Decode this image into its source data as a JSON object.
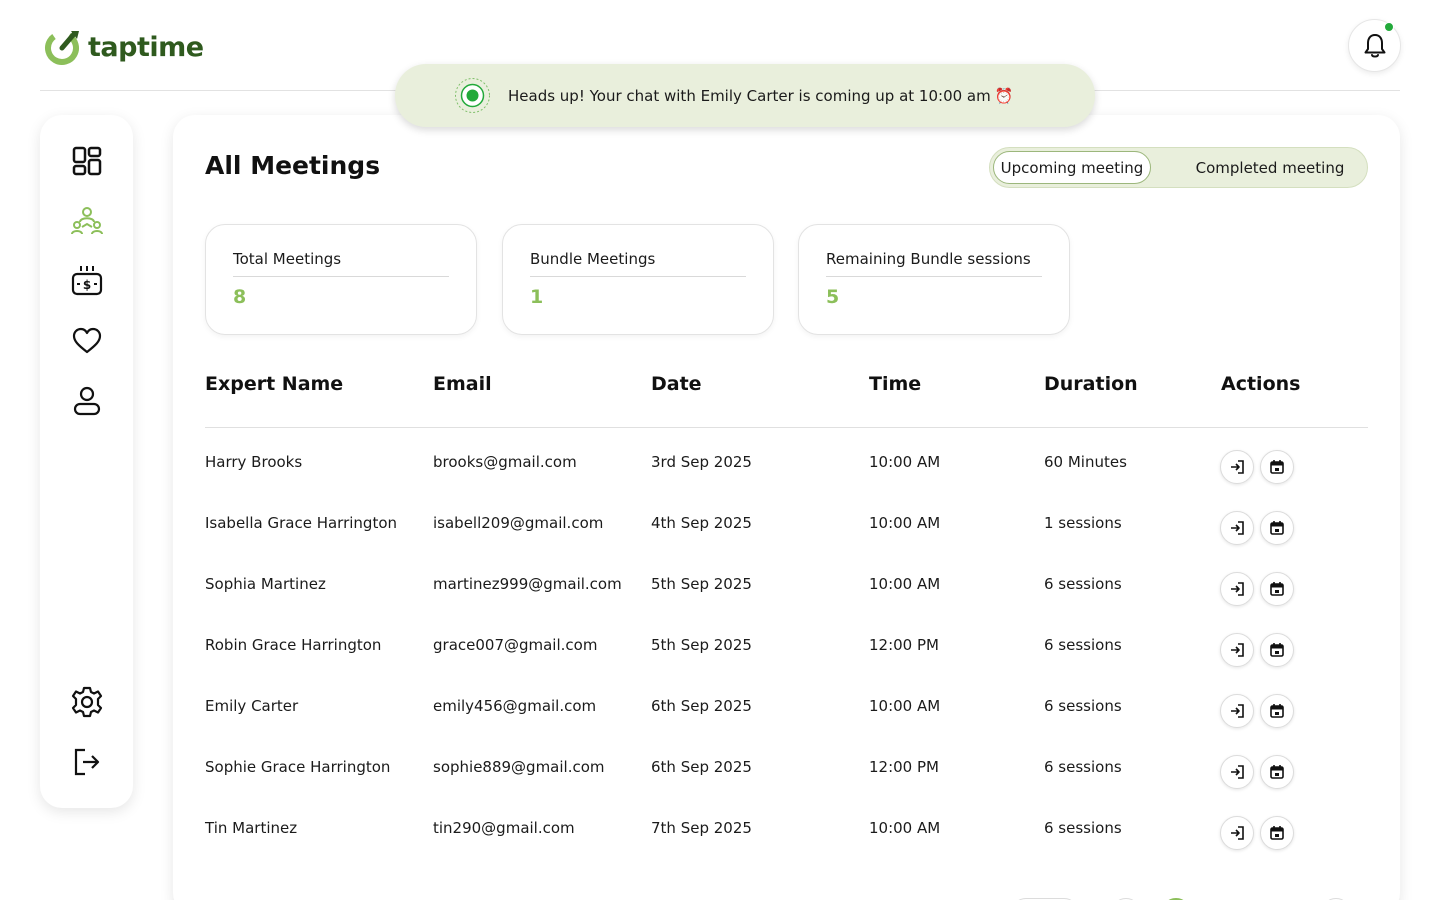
{
  "app": {
    "name": "taptime",
    "brand_color": "#2f5a1e",
    "accent": "#8cbf5a"
  },
  "header": {
    "notification_icon": "bell-icon",
    "has_unread": true
  },
  "toast": {
    "message": "Heads up! Your chat with Emily Carter is coming up at 10:00 am",
    "emoji": "⏰"
  },
  "sidebar": {
    "items": [
      {
        "name": "dashboard",
        "icon": "dashboard-grid-icon",
        "active": false
      },
      {
        "name": "meetings",
        "icon": "group-meeting-icon",
        "active": true
      },
      {
        "name": "payments",
        "icon": "money-box-icon",
        "active": false
      },
      {
        "name": "favorites",
        "icon": "heart-icon",
        "active": false
      },
      {
        "name": "profile",
        "icon": "user-icon",
        "active": false
      }
    ],
    "bottom_items": [
      {
        "name": "settings",
        "icon": "gear-icon"
      },
      {
        "name": "logout",
        "icon": "logout-icon"
      }
    ]
  },
  "main": {
    "title": "All Meetings",
    "tabs": {
      "upcoming": "Upcoming meeting",
      "completed": "Completed meeting",
      "selected": "upcoming"
    },
    "stats": [
      {
        "label": "Total Meetings",
        "value": "8"
      },
      {
        "label": "Bundle Meetings",
        "value": "1"
      },
      {
        "label": "Remaining Bundle sessions",
        "value": "5"
      }
    ],
    "table": {
      "headers": [
        "Expert Name",
        "Email",
        "Date",
        "Time",
        "Duration",
        "Actions"
      ],
      "rows": [
        {
          "name": "Harry Brooks",
          "email": "brooks@gmail.com",
          "date": "3rd Sep 2025",
          "time": "10:00 AM",
          "duration": "60 Minutes"
        },
        {
          "name": "Isabella Grace Harrington",
          "email": "isabell209@gmail.com",
          "date": "4th Sep 2025",
          "time": "10:00 AM",
          "duration": "1 sessions"
        },
        {
          "name": "Sophia Martinez",
          "email": "martinez999@gmail.com",
          "date": "5th Sep 2025",
          "time": "10:00 AM",
          "duration": "6 sessions"
        },
        {
          "name": "Robin Grace Harrington",
          "email": "grace007@gmail.com",
          "date": "5th Sep 2025",
          "time": "12:00 PM",
          "duration": "6 sessions"
        },
        {
          "name": "Emily Carter",
          "email": "emily456@gmail.com",
          "date": "6th Sep 2025",
          "time": "10:00 AM",
          "duration": "6 sessions"
        },
        {
          "name": "Sophie Grace Harrington",
          "email": "sophie889@gmail.com",
          "date": "6th Sep 2025",
          "time": "12:00 PM",
          "duration": "6 sessions"
        },
        {
          "name": "Tin Martinez",
          "email": "tin290@gmail.com",
          "date": "7th Sep 2025",
          "time": "10:00 AM",
          "duration": "6 sessions"
        }
      ],
      "row_actions": [
        "join-icon",
        "calendar-icon"
      ]
    }
  }
}
